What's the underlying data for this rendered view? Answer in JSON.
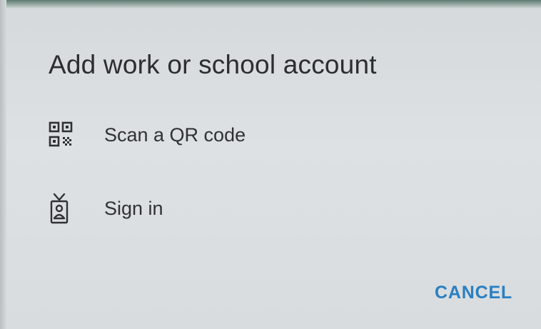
{
  "dialog": {
    "title": "Add work or school account",
    "options": [
      {
        "label": "Scan a QR code",
        "icon": "qr-code-icon"
      },
      {
        "label": "Sign in",
        "icon": "id-badge-icon"
      }
    ],
    "cancel_label": "CANCEL"
  },
  "colors": {
    "accent": "#2a7fc1",
    "title_text": "#2b2d2f",
    "body_text": "#2f3133",
    "background": "#d9dddf"
  }
}
